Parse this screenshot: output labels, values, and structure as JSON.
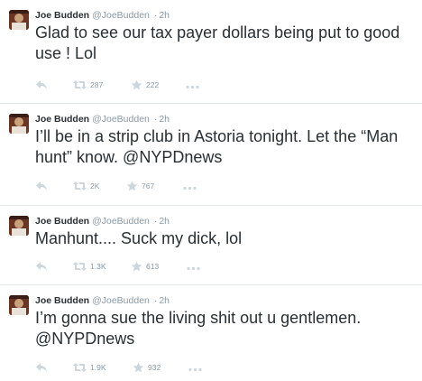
{
  "tweets": [
    {
      "name": "Joe Budden",
      "handle": "@JoeBudden",
      "dot": "·",
      "time": "2h",
      "text": "Glad to see our tax payer dollars being put to good use ! Lol",
      "retweets": "287",
      "favorites": "222"
    },
    {
      "name": "Joe Budden",
      "handle": "@JoeBudden",
      "dot": "·",
      "time": "2h",
      "text": "I’ll be in a strip club in Astoria tonight. Let the “Man hunt” know. @NYPDnews",
      "retweets": "2K",
      "favorites": "767"
    },
    {
      "name": "Joe Budden",
      "handle": "@JoeBudden",
      "dot": "·",
      "time": "2h",
      "text": "Manhunt.... Suck my dick, lol",
      "retweets": "1.3K",
      "favorites": "613"
    },
    {
      "name": "Joe Budden",
      "handle": "@JoeBudden",
      "dot": "·",
      "time": "2h",
      "text": "I’m gonna sue the living shit out u gentlemen. @NYPDnews",
      "retweets": "1.9K",
      "favorites": "932"
    }
  ],
  "icons": {
    "reply": "reply-icon",
    "retweet": "retweet-icon",
    "favorite": "star-icon",
    "more": "more-icon"
  },
  "colors": {
    "text": "#292f33",
    "muted": "#8899a6",
    "icon": "#ccd6dd",
    "divider": "#e1e8ed"
  }
}
